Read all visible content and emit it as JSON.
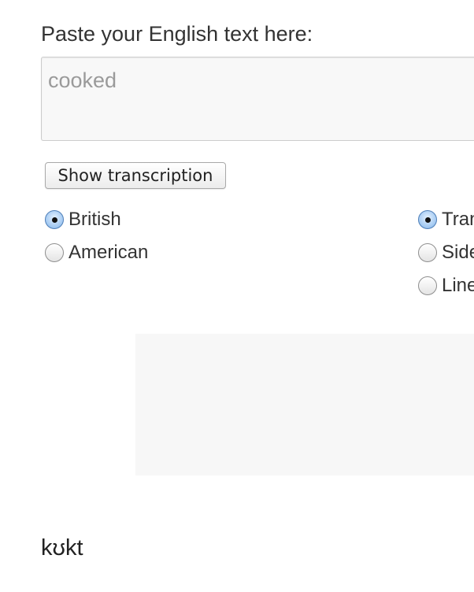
{
  "form": {
    "prompt_label": "Paste your English text here:",
    "input_value": "",
    "input_placeholder": "cooked",
    "submit_label": "Show transcription"
  },
  "accent_options": [
    {
      "label": "British",
      "checked": true
    },
    {
      "label": "American",
      "checked": false
    }
  ],
  "display_options": [
    {
      "label": "Tran",
      "checked": true
    },
    {
      "label": "Side",
      "checked": false
    },
    {
      "label": "Line",
      "checked": false
    }
  ],
  "footer": {
    "logo_text": "kʊkt"
  },
  "colors": {
    "accent": "#7fb1e6",
    "input_background": "#f8f8f8",
    "result_background": "#f7f7f7"
  }
}
